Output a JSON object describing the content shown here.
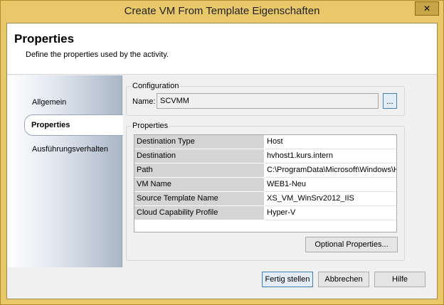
{
  "window": {
    "title": "Create VM From Template Eigenschaften",
    "close_glyph": "✕"
  },
  "header": {
    "title": "Properties",
    "description": "Define the properties used by the activity."
  },
  "nav": {
    "items": [
      {
        "label": "Allgemein"
      },
      {
        "label": "Properties"
      },
      {
        "label": "Ausführungsverhalten"
      }
    ]
  },
  "configuration": {
    "group_label": "Configuration",
    "name_label": "Name:",
    "name_value": "SCVMM",
    "browse_label": "..."
  },
  "properties": {
    "group_label": "Properties",
    "rows": [
      {
        "key": "Destination Type",
        "value": "Host"
      },
      {
        "key": "Destination",
        "value": "hvhost1.kurs.intern"
      },
      {
        "key": "Path",
        "value": "C:\\ProgramData\\Microsoft\\Windows\\H"
      },
      {
        "key": "VM Name",
        "value": "WEB1-Neu"
      },
      {
        "key": "Source Template Name",
        "value": "XS_VM_WinSrv2012_IIS"
      },
      {
        "key": "Cloud Capability Profile",
        "value": "Hyper-V"
      }
    ],
    "optional_button": "Optional Properties..."
  },
  "footer": {
    "ok": "Fertig stellen",
    "cancel": "Abbrechen",
    "help": "Hilfe"
  }
}
